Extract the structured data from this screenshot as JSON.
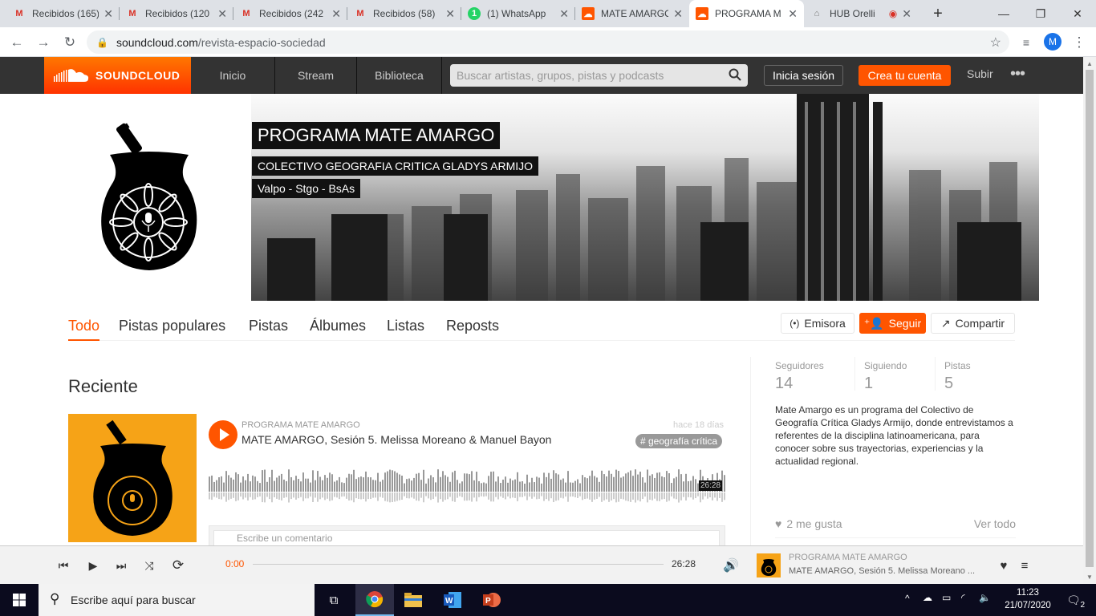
{
  "browser": {
    "tabs": [
      {
        "icon": "gmail-icon",
        "title": "Recibidos (165)"
      },
      {
        "icon": "gmail-icon",
        "title": "Recibidos (120"
      },
      {
        "icon": "gmail-icon",
        "title": "Recibidos (242"
      },
      {
        "icon": "gmail-icon",
        "title": "Recibidos (58)"
      },
      {
        "icon": "whatsapp-icon",
        "title": "(1) WhatsApp"
      },
      {
        "icon": "soundcloud-icon",
        "title": "MATE AMARGO"
      },
      {
        "icon": "soundcloud-icon",
        "title": "PROGRAMA M"
      },
      {
        "icon": "hub-icon",
        "title": "HUB Orelli"
      }
    ],
    "whatsapp_badge": "1",
    "url_domain": "soundcloud.com",
    "url_path": "/revista-espacio-sociedad",
    "profile_initial": "M"
  },
  "sc": {
    "logo_text": "SOUNDCLOUD",
    "nav": [
      "Inicio",
      "Stream",
      "Biblioteca"
    ],
    "search_placeholder": "Buscar artistas, grupos, pistas y podcasts",
    "signin": "Inicia sesión",
    "create": "Crea tu cuenta",
    "upload": "Subir",
    "more": "•••"
  },
  "profile": {
    "name": "PROGRAMA MATE AMARGO",
    "subtitle": "COLECTIVO GEOGRAFIA CRITICA GLADYS ARMIJO",
    "location": "Valpo - Stgo - BsAs",
    "tabs": [
      "Todo",
      "Pistas populares",
      "Pistas",
      "Álbumes",
      "Listas",
      "Reposts"
    ],
    "actions": {
      "station": "Emisora",
      "follow": "Seguir",
      "share": "Compartir"
    }
  },
  "recent": {
    "heading": "Reciente",
    "track": {
      "user": "PROGRAMA MATE AMARGO",
      "title": "MATE AMARGO, Sesión 5. Melissa Moreano & Manuel Bayon",
      "date": "hace 18 días",
      "tag": "# geografía crítica",
      "duration": "26:28",
      "comment_placeholder": "Escribe un comentario"
    }
  },
  "sidebar": {
    "stats": [
      {
        "label": "Seguidores",
        "value": "14"
      },
      {
        "label": "Siguiendo",
        "value": "1"
      },
      {
        "label": "Pistas",
        "value": "5"
      }
    ],
    "bio": "Mate Amargo es un programa del Colectivo de Geografía Crítica Gladys Armijo, donde entrevistamos a referentes de la disciplina latinoamericana, para conocer sobre sus trayectorias, experiencias y la actualidad regional.",
    "likes": "2 me gusta",
    "view_all": "Ver todo"
  },
  "player": {
    "current": "0:00",
    "duration": "26:28",
    "progress": 0,
    "user": "PROGRAMA MATE AMARGO",
    "title": "MATE AMARGO, Sesión 5. Melissa Moreano ..."
  },
  "taskbar": {
    "search_placeholder": "Escribe aquí para buscar",
    "time": "11:23",
    "date": "21/07/2020",
    "notifications": "2"
  },
  "colors": {
    "accent": "#ff5500",
    "header": "#333333",
    "cover": "#f6a317"
  }
}
